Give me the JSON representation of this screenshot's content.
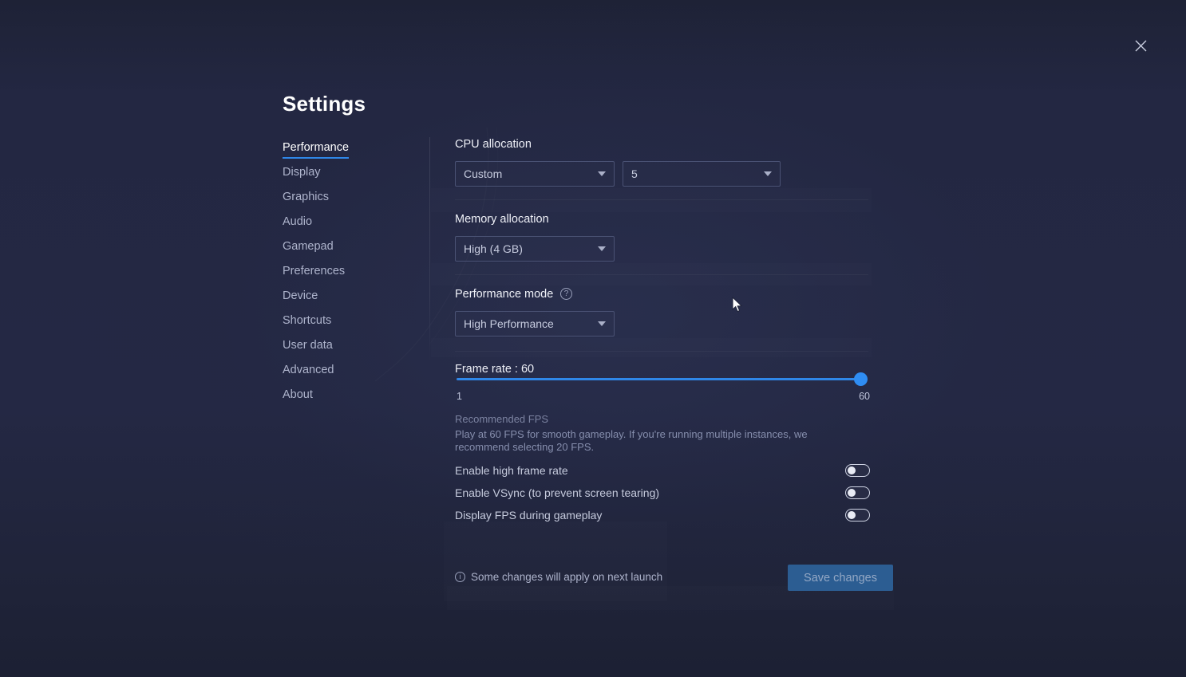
{
  "window": {
    "title": "Settings",
    "close_icon": "close-icon",
    "background_color": "#232742",
    "accent_color": "#2f87e8"
  },
  "sidebar": {
    "items": [
      {
        "label": "Performance",
        "active": true
      },
      {
        "label": "Display",
        "active": false
      },
      {
        "label": "Graphics",
        "active": false
      },
      {
        "label": "Audio",
        "active": false
      },
      {
        "label": "Gamepad",
        "active": false
      },
      {
        "label": "Preferences",
        "active": false
      },
      {
        "label": "Device",
        "active": false
      },
      {
        "label": "Shortcuts",
        "active": false
      },
      {
        "label": "User data",
        "active": false
      },
      {
        "label": "Advanced",
        "active": false
      },
      {
        "label": "About",
        "active": false
      }
    ]
  },
  "performance": {
    "cpu": {
      "label": "CPU allocation",
      "mode_value": "Custom",
      "cores_value": "5"
    },
    "memory": {
      "label": "Memory allocation",
      "value": "High (4 GB)"
    },
    "mode": {
      "label": "Performance mode",
      "help_icon": "question-mark-icon",
      "value": "High Performance"
    },
    "frame_rate": {
      "label": "Frame rate : 60",
      "value": 60,
      "min": 1,
      "max": 60,
      "min_label": "1",
      "max_label": "60",
      "recommended_title": "Recommended FPS",
      "recommended_body": "Play at 60 FPS for smooth gameplay. If you're running multiple instances, we recommend selecting 20 FPS."
    },
    "toggles": [
      {
        "label": "Enable high frame rate",
        "on": false
      },
      {
        "label": "Enable VSync (to prevent screen tearing)",
        "on": false
      },
      {
        "label": "Display FPS during gameplay",
        "on": false
      }
    ]
  },
  "footer": {
    "info_icon": "info-icon",
    "note": "Some changes will apply on next launch",
    "save_label": "Save changes",
    "save_enabled": false
  }
}
